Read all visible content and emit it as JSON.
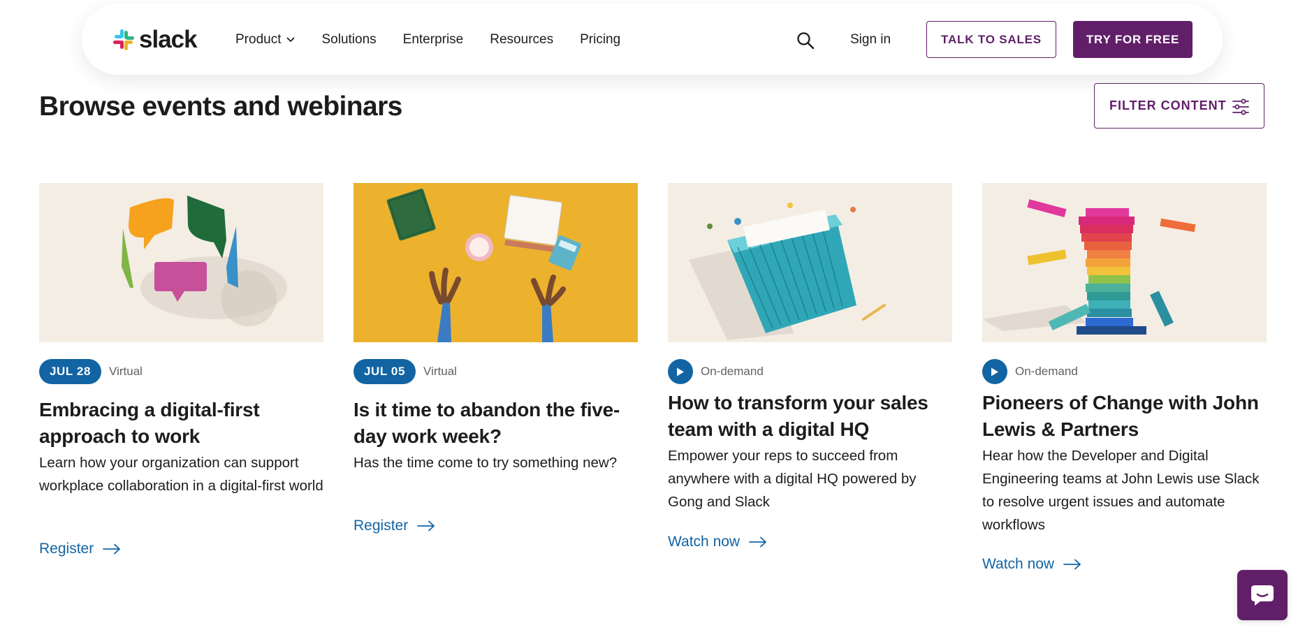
{
  "brand": {
    "name": "slack"
  },
  "nav": {
    "links": [
      "Product",
      "Solutions",
      "Enterprise",
      "Resources",
      "Pricing"
    ],
    "sign_in": "Sign in",
    "talk_to_sales": "TALK TO SALES",
    "try_free": "TRY FOR FREE"
  },
  "main": {
    "title": "Browse events and webinars",
    "filter_label": "FILTER CONTENT"
  },
  "cards": [
    {
      "date": "JUL 28",
      "type": "Virtual",
      "title": "Embracing a digital-first approach to work",
      "description": "Learn how your organization can support workplace collaboration in a digital-first world",
      "cta": "Register"
    },
    {
      "date": "JUL 05",
      "type": "Virtual",
      "title": "Is it time to abandon the five-day work week?",
      "description": "Has the time come to try something new?",
      "cta": "Register"
    },
    {
      "type": "On-demand",
      "title": "How to transform your sales team with a digital HQ",
      "description": "Empower your reps to succeed from anywhere with a digital HQ powered by Gong and Slack",
      "cta": "Watch now"
    },
    {
      "type": "On-demand",
      "title": "Pioneers of Change with John Lewis & Partners",
      "description": "Hear how the Developer and Digital Engineering teams at John Lewis use Slack to resolve urgent issues and automate workflows",
      "cta": "Watch now"
    }
  ],
  "colors": {
    "aubergine": "#611f69",
    "link_blue": "#1264a3",
    "text": "#1d1c1d",
    "muted": "#616061",
    "card_bg": "#f4ede4",
    "mustard": "#ecb22e"
  },
  "icons": {
    "search": "search-icon",
    "filter": "sliders-icon",
    "arrow": "arrow-right-icon",
    "play": "play-icon",
    "chat": "chat-bubble-icon",
    "chevron": "chevron-down-icon"
  }
}
